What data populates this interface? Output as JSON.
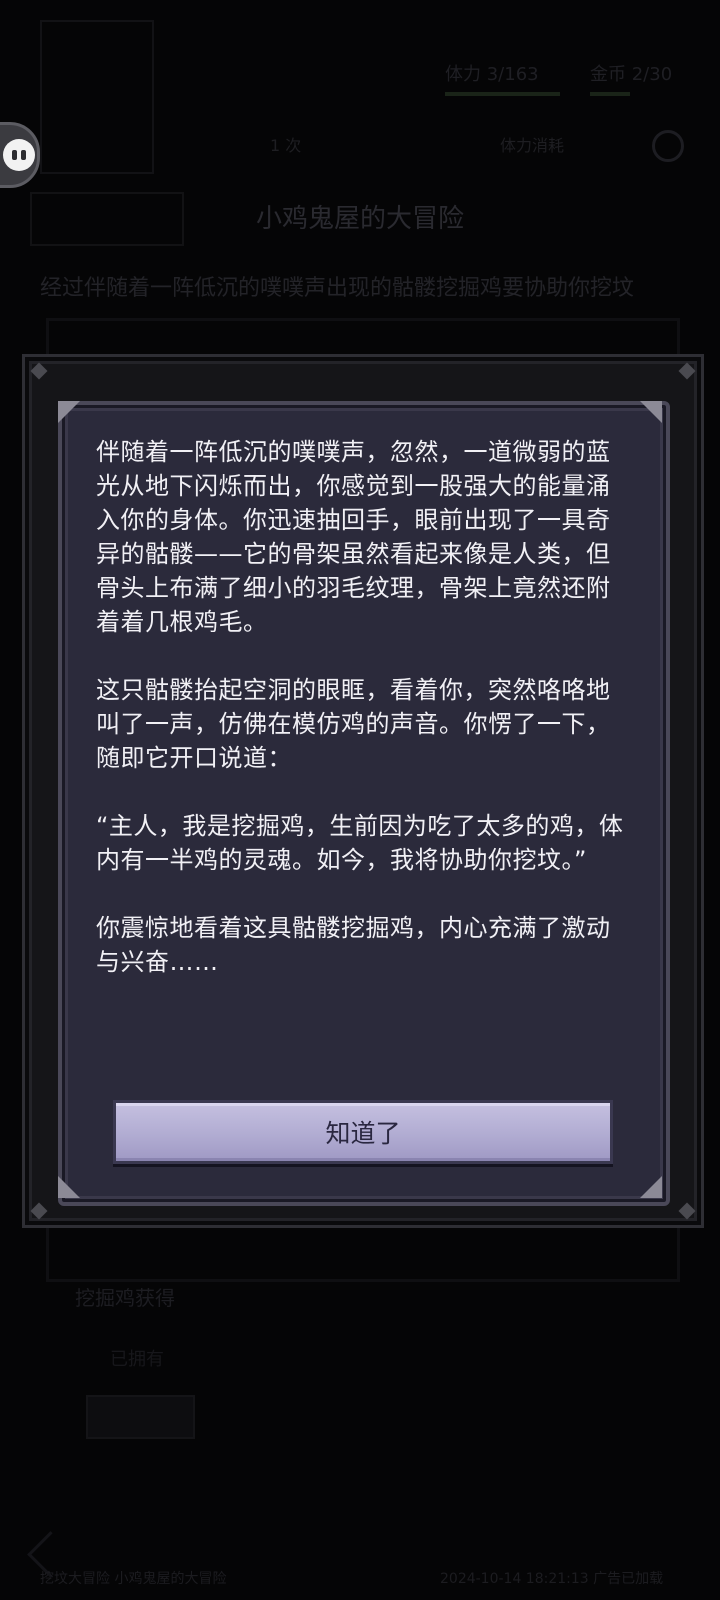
{
  "background": {
    "title": "小鸡鬼屋的大冒险",
    "description": "经过伴随着一阵低沉的噗噗声出现的骷髅挖掘鸡要协助你挖坟",
    "stats": [
      "体力 3/163",
      "金币 2/30"
    ],
    "nav": [
      "1 次",
      "体力消耗"
    ],
    "label": "挖掘鸡获得",
    "small": "已拥有",
    "footer_left": "挖坟大冒险 小鸡鬼屋的大冒险",
    "footer_right": "2024-10-14 18:21:13 广告已加载"
  },
  "dialog": {
    "paragraphs": [
      "伴随着一阵低沉的噗噗声，忽然，一道微弱的蓝光从地下闪烁而出，你感觉到一股强大的能量涌入你的身体。你迅速抽回手，眼前出现了一具奇异的骷髅——它的骨架虽然看起来像是人类，但骨头上布满了细小的羽毛纹理，骨架上竟然还附着着几根鸡毛。",
      "这只骷髅抬起空洞的眼眶，看着你，突然咯咯地叫了一声，仿佛在模仿鸡的声音。你愣了一下，随即它开口说道：",
      "“主人，我是挖掘鸡，生前因为吃了太多的鸡，体内有一半鸡的灵魂。如今，我将协助你挖坟。”",
      "你震惊地看着这具骷髅挖掘鸡，内心充满了激动与兴奋……"
    ],
    "confirm_label": "知道了"
  },
  "colors": {
    "panel": "#2b2a3b",
    "button": "#b1acd2",
    "text": "#f1f0f5"
  },
  "icons": {
    "side_bubble": "assistant-bubble-icon",
    "settings": "gear-icon"
  }
}
